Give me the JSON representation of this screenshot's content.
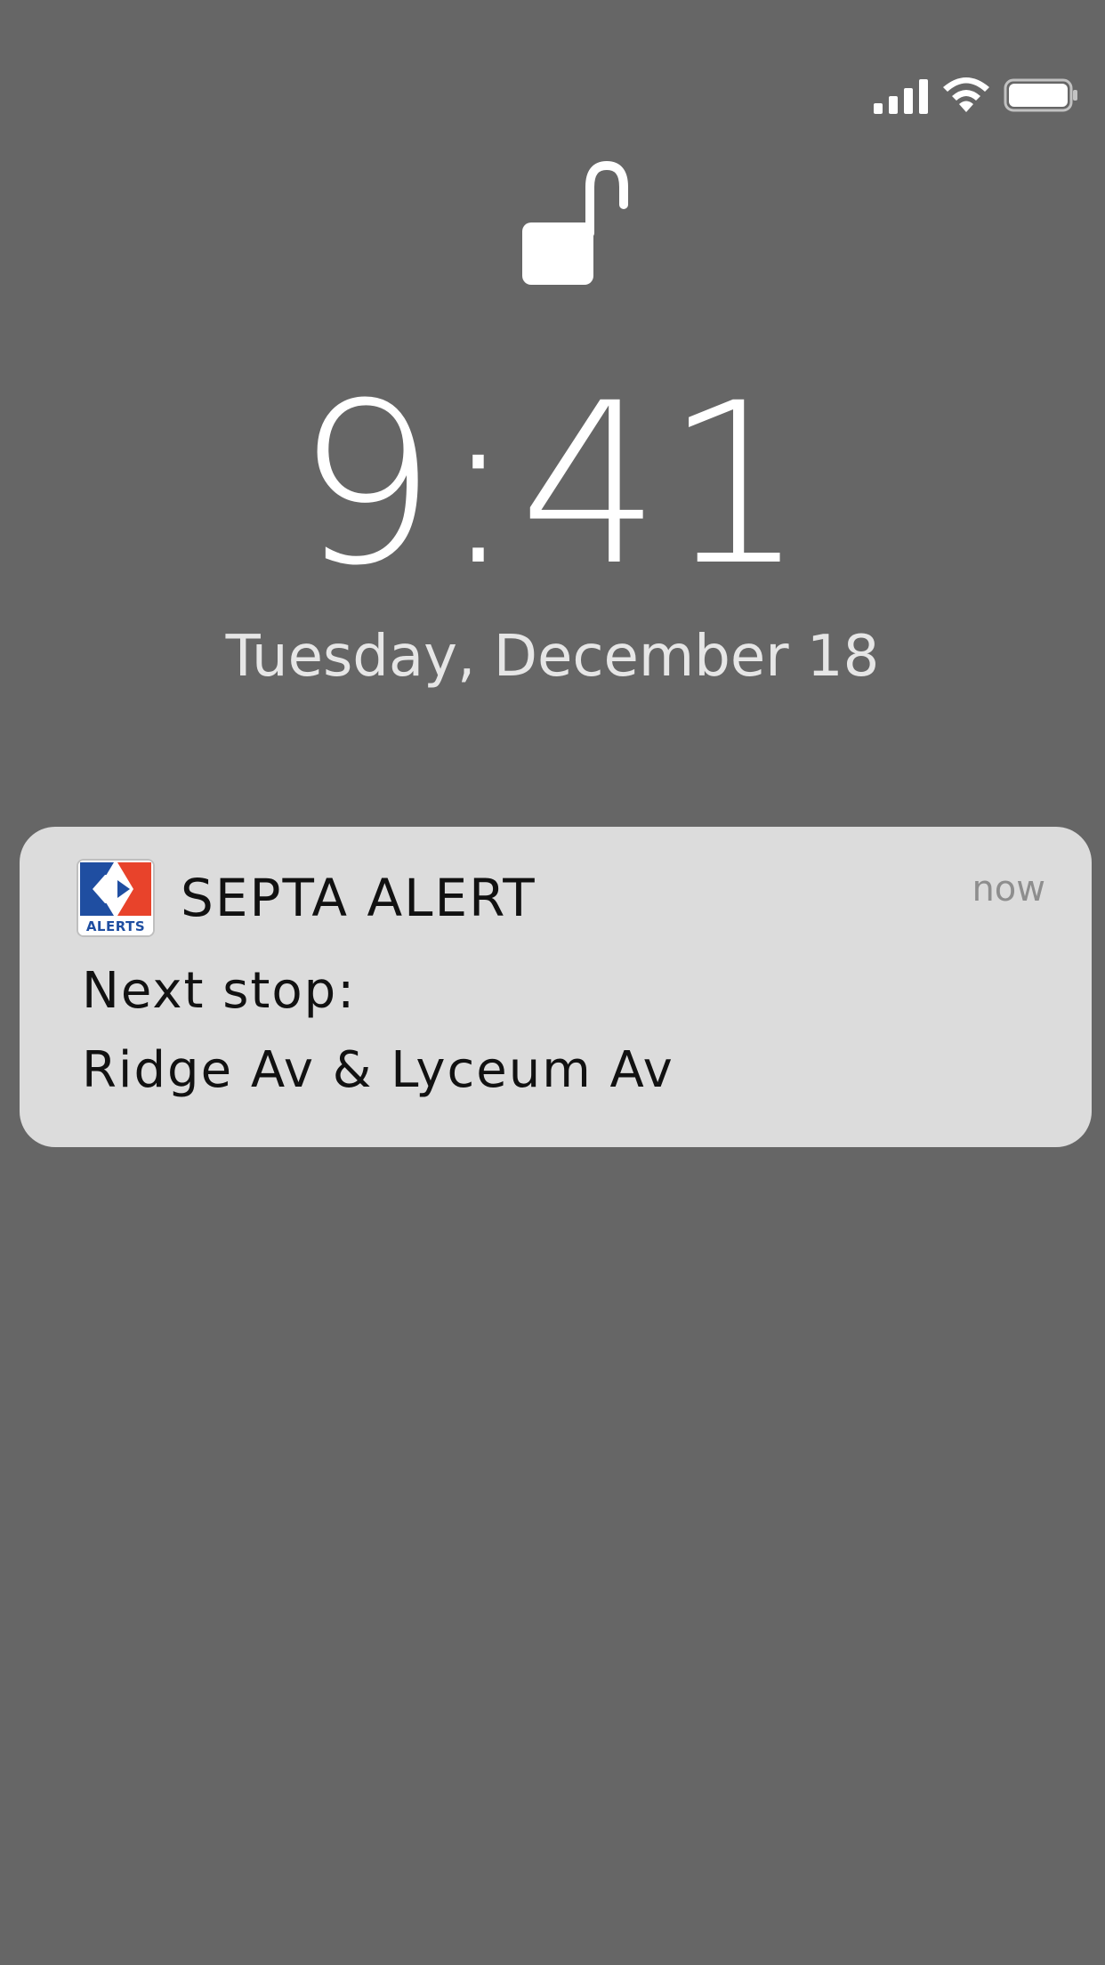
{
  "status_bar": {
    "signal_icon": "cellular-signal-icon",
    "wifi_icon": "wifi-icon",
    "battery_icon": "battery-icon"
  },
  "lock_screen": {
    "lock_icon": "unlocked-padlock-icon",
    "time": "9:41",
    "date": "Tuesday, December 18"
  },
  "notification": {
    "app_icon": "septa-alerts-logo",
    "app_icon_label": "ALERTS",
    "app_name": "SEPTA ALERT",
    "time": "now",
    "body_line_1": "Next stop:",
    "body_line_2": "Ridge Av & Lyceum Av"
  },
  "colors": {
    "background": "#666666",
    "notification_background": "#dcdcdc",
    "septa_blue": "#1f4ea1",
    "septa_red": "#e8432b"
  }
}
